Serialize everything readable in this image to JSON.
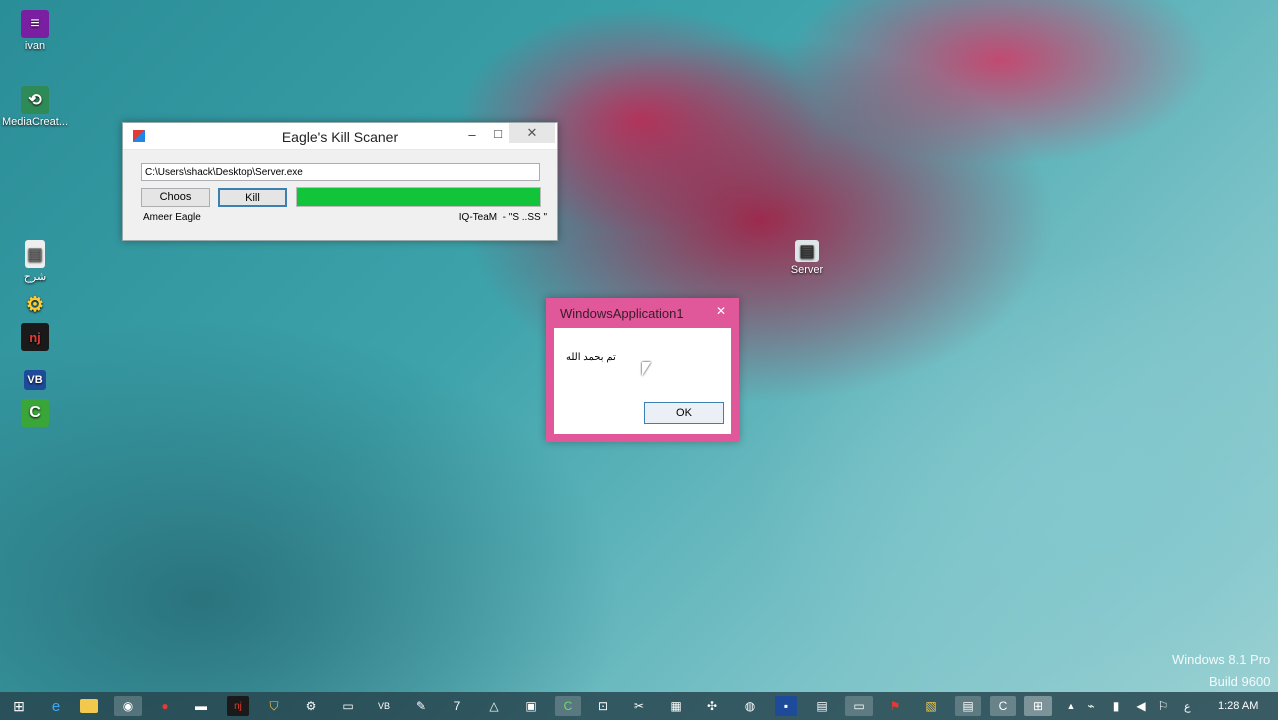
{
  "desktop": {
    "icons": [
      {
        "label": "ivan",
        "color": "#7b1fa2"
      },
      {
        "label": "MediaCreat...",
        "color": "#2e8b57"
      },
      {
        "label": "شرح",
        "color": "#eeeeee"
      },
      {
        "label": "",
        "color": "#4caf50"
      },
      {
        "label": "",
        "color": "#b71c1c"
      },
      {
        "label": "",
        "color": "#1e4a9a"
      },
      {
        "label": "",
        "color": "#3aa63a"
      }
    ],
    "server_icon_label": "Server",
    "watermark_line1": "Windows 8.1 Pro",
    "watermark_line2": "Build 9600"
  },
  "main_window": {
    "title": "Eagle's Kill Scaner",
    "minimize": "–",
    "maximize": "□",
    "close": "✕",
    "path_value": "C:\\Users\\shack\\Desktop\\Server.exe",
    "choose_label": "Choos",
    "kill_label": "Kill",
    "progress": 1.0,
    "progress_color": "#12c43a",
    "author_label": "Ameer Eagle",
    "team_label": "IQ-TeaM  - \"S ..SS \""
  },
  "dialog": {
    "title": "WindowsApplication1",
    "close": "✕",
    "message": "تم بحمد الله",
    "ok_label": "OK",
    "accent": "#e0589a"
  },
  "taskbar": {
    "start_icon": "windows-logo-icon",
    "time": "1:28 AM",
    "lang": "ع",
    "tray_arrow": "▲"
  }
}
